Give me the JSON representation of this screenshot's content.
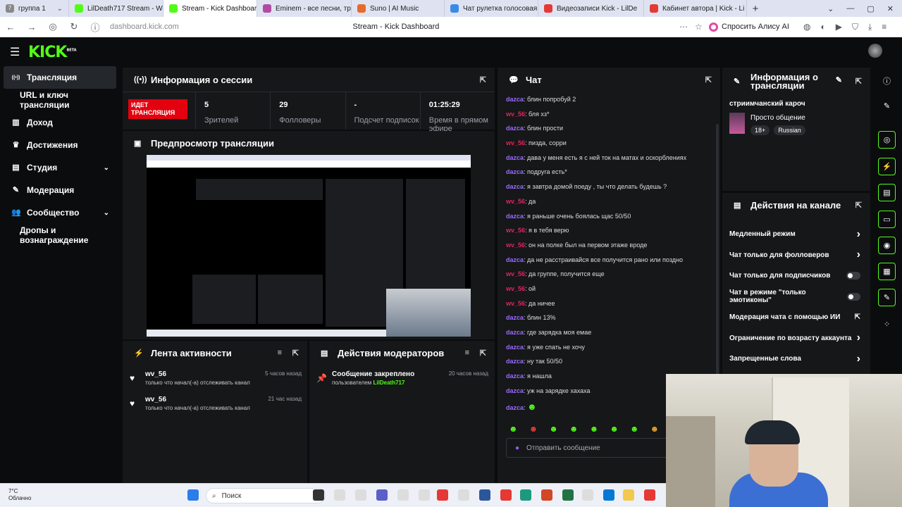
{
  "browser": {
    "tabs": [
      {
        "label": "группа 1",
        "badge": "7",
        "color": "#888",
        "active": false
      },
      {
        "label": "LilDeath717 Stream - Wat",
        "color": "#53fc18",
        "active": false
      },
      {
        "label": "Stream - Kick Dashboar",
        "color": "#53fc18",
        "active": true
      },
      {
        "label": "Eminem - все песни, трек",
        "color": "#b24aa3",
        "active": false
      },
      {
        "label": "Suno | AI Music",
        "color": "#e86a2a",
        "active": false
      },
      {
        "label": "Чат рулетка голосовая —",
        "color": "#3a8be8",
        "active": false
      },
      {
        "label": "Видеозаписи Kick - LilDe",
        "color": "#e53935",
        "active": false
      },
      {
        "label": "Кабинет автора | Kick - Li",
        "color": "#e53935",
        "active": false
      }
    ],
    "url": "dashboard.kick.com",
    "page_title": "Stream - Kick Dashboard",
    "ask_alice": "Спросить Алису AI"
  },
  "kick": {
    "logo": "KICK",
    "logo_badge": "BETA"
  },
  "sidebar": {
    "items": [
      {
        "label": "Трансляция",
        "icon": "broadcast-icon",
        "active": true
      },
      {
        "label": "URL и ключ трансляции",
        "icon": "",
        "sub": true
      },
      {
        "label": "Доход",
        "icon": "chart-icon"
      },
      {
        "label": "Достижения",
        "icon": "trophy-icon"
      },
      {
        "label": "Студия",
        "icon": "layout-icon",
        "chevron": true
      },
      {
        "label": "Модерация",
        "icon": "wrench-icon"
      },
      {
        "label": "Сообщество",
        "icon": "users-icon",
        "chevron": true
      },
      {
        "label": "Дропы и вознаграждение",
        "icon": "",
        "sub": true
      }
    ]
  },
  "session": {
    "title": "Информация о сессии",
    "live_badge": "ИДЕТ ТРАНСЛЯЦИЯ",
    "stats": [
      {
        "value": "5",
        "label": "Зрителей"
      },
      {
        "value": "29",
        "label": "Фолловеры"
      },
      {
        "value": "-",
        "label": "Подсчет подписок"
      },
      {
        "value": "01:25:29",
        "label": "Время в прямом эфире"
      }
    ]
  },
  "preview": {
    "title": "Предпросмотр трансляции"
  },
  "activity": {
    "title": "Лента активности",
    "items": [
      {
        "name": "wv_56",
        "desc": "только что начал(-а) отслеживать канал",
        "time": "5 часов назад"
      },
      {
        "name": "wv_56",
        "desc": "только что начал(-а) отслеживать канал",
        "time": "21 час назад"
      }
    ]
  },
  "mod_actions": {
    "title": "Действия модераторов",
    "items": [
      {
        "text": "Сообщение закреплено",
        "by_prefix": "пользователем",
        "by_user": "LilDeath717",
        "time": "20 часов назад"
      }
    ]
  },
  "chat": {
    "title": "Чат",
    "messages": [
      {
        "user": "dazca",
        "color": "#9b6bff",
        "text": "блин попробуй 2"
      },
      {
        "user": "wv_56",
        "color": "#e0245e",
        "text": "бля хз*"
      },
      {
        "user": "dazca",
        "color": "#9b6bff",
        "text": "блин прости"
      },
      {
        "user": "wv_56",
        "color": "#e0245e",
        "text": "пизда, сорри"
      },
      {
        "user": "dazca",
        "color": "#9b6bff",
        "text": "дава у меня есть я с ней ток на матах и оскорблениях"
      },
      {
        "user": "dazca",
        "color": "#9b6bff",
        "text": "подруга есть*"
      },
      {
        "user": "dazca",
        "color": "#9b6bff",
        "text": "я завтра домой поеду , ты что делать будешь ?"
      },
      {
        "user": "wv_56",
        "color": "#e0245e",
        "text": "да"
      },
      {
        "user": "dazca",
        "color": "#9b6bff",
        "text": "я раньше очень боялась щас 50/50"
      },
      {
        "user": "wv_56",
        "color": "#e0245e",
        "text": "я в тебя верю"
      },
      {
        "user": "wv_56",
        "color": "#e0245e",
        "text": "он на полке был на первом этаже вроде"
      },
      {
        "user": "dazca",
        "color": "#9b6bff",
        "text": "да не расстраивайся все получится рано или поздно"
      },
      {
        "user": "wv_56",
        "color": "#e0245e",
        "text": "да группе, получится еще"
      },
      {
        "user": "wv_56",
        "color": "#e0245e",
        "text": "ой"
      },
      {
        "user": "wv_56",
        "color": "#e0245e",
        "text": "да ничее"
      },
      {
        "user": "dazca",
        "color": "#9b6bff",
        "text": "блин 13%"
      },
      {
        "user": "dazca",
        "color": "#9b6bff",
        "text": "где зарядка моя емае"
      },
      {
        "user": "dazca",
        "color": "#9b6bff",
        "text": "я уже спать не хочу"
      },
      {
        "user": "dazca",
        "color": "#9b6bff",
        "text": "ну так 50/50"
      },
      {
        "user": "dazca",
        "color": "#9b6bff",
        "text": "я нашла"
      },
      {
        "user": "dazca",
        "color": "#9b6bff",
        "text": "уж на зарядке хахаха"
      },
      {
        "user": "dazca",
        "color": "#9b6bff",
        "text": ""
      }
    ],
    "input_placeholder": "Отправить сообщение"
  },
  "stream_info": {
    "title": "Информация о трансляции",
    "stream_title": "стриимчанский кароч",
    "category": "Просто общение",
    "tags": [
      "18+",
      "Russian"
    ]
  },
  "channel_actions": {
    "title": "Действия на канале",
    "items": [
      {
        "label": "Медленный режим",
        "control": "chevron"
      },
      {
        "label": "Чат только для фолловеров",
        "control": "chevron"
      },
      {
        "label": "Чат только для подписчиков",
        "control": "toggle"
      },
      {
        "label": "Чат в режиме \"только эмотиконы\"",
        "control": "toggle"
      },
      {
        "label": "Модерация чата с помощью ИИ",
        "control": "external"
      },
      {
        "label": "Ограничение по возрасту аккаунта",
        "control": "chevron"
      },
      {
        "label": "Запрещенные слова",
        "control": "chevron"
      }
    ]
  },
  "taskbar": {
    "temp": "7°C",
    "weather": "Облачно",
    "search": "Поиск"
  }
}
